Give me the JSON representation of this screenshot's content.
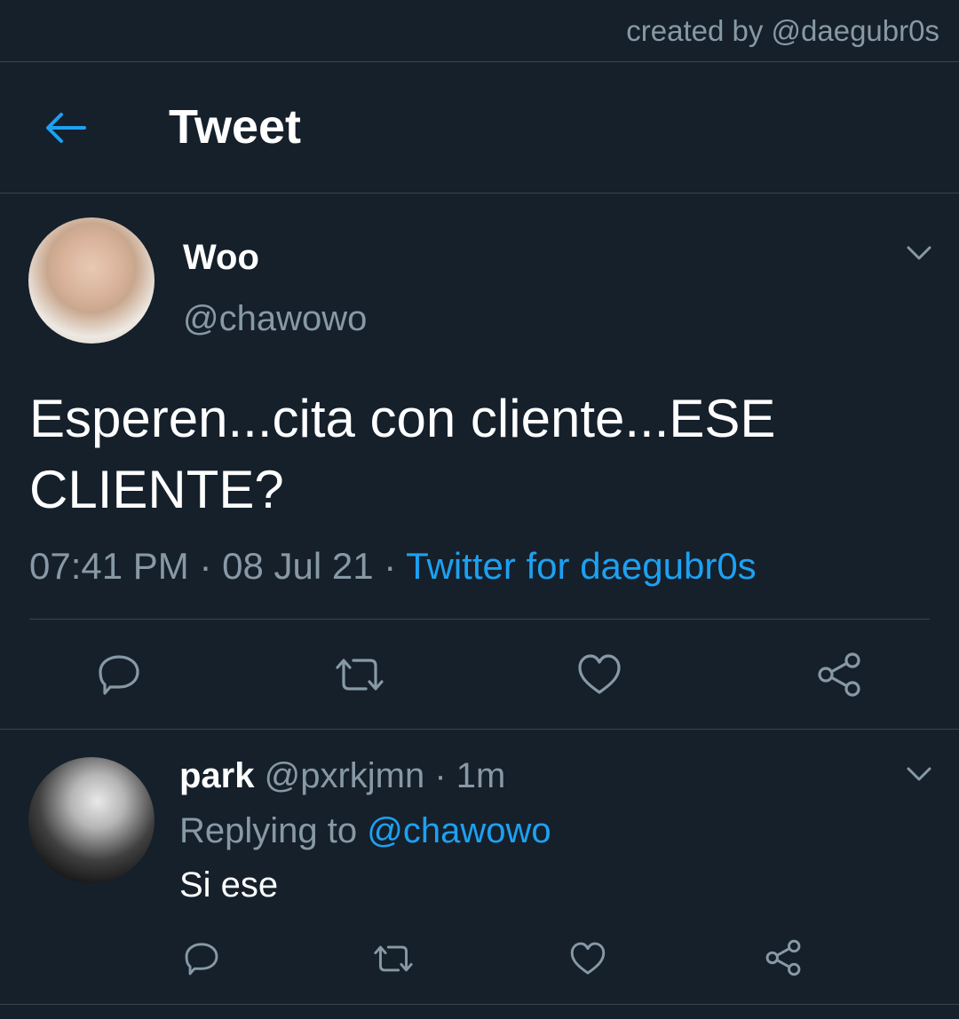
{
  "watermark": "created by @daegubr0s",
  "header": {
    "title": "Tweet",
    "back_icon": "arrow-left-icon"
  },
  "tweet": {
    "author_name": "Woo",
    "author_handle": "@chawowo",
    "text": "Esperen...cita con cliente...ESE CLIENTE?",
    "time": "07:41 PM",
    "separator": " · ",
    "date": "08 Jul 21",
    "client": "Twitter for daegubr0s"
  },
  "reply": {
    "name": "park",
    "handle": "@pxrkjmn",
    "separator": " · ",
    "time": "1m",
    "replying_prefix": "Replying to ",
    "replying_to": "@chawowo",
    "text": "Si ese"
  },
  "colors": {
    "background": "#15202b",
    "divider": "#38444d",
    "secondary_text": "#8899a6",
    "accent": "#1da1f2",
    "primary_text": "#ffffff"
  },
  "icons": {
    "actions": [
      "reply-icon",
      "retweet-icon",
      "like-icon",
      "share-icon"
    ],
    "menu": "chevron-down-icon"
  }
}
